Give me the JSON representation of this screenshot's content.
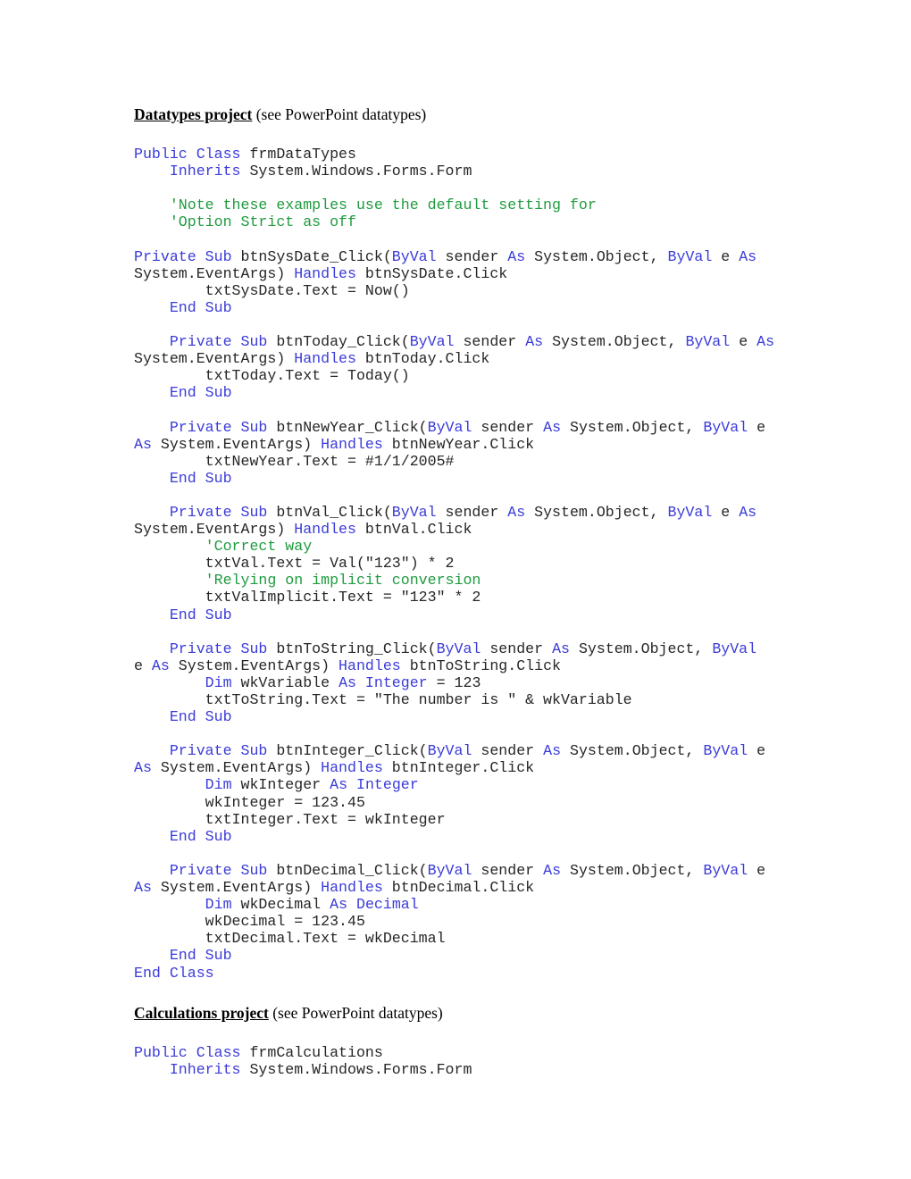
{
  "document": {
    "sections": [
      {
        "id": "datatypes",
        "heading_title": "Datatypes project",
        "heading_suffix": " (see PowerPoint datatypes)",
        "code_lines": [
          [
            {
              "t": "Public Class ",
              "c": "kw"
            },
            {
              "t": "frmDataTypes",
              "c": "id"
            }
          ],
          [
            {
              "t": "    ",
              "c": "id"
            },
            {
              "t": "Inherits ",
              "c": "kw"
            },
            {
              "t": "System.Windows.Forms.Form",
              "c": "id"
            }
          ],
          [],
          [
            {
              "t": "    'Note these examples use the default setting for",
              "c": "cmt"
            }
          ],
          [
            {
              "t": "    'Option Strict as off",
              "c": "cmt"
            }
          ],
          [],
          [
            {
              "t": "Private Sub ",
              "c": "kw"
            },
            {
              "t": "btnSysDate_Click(",
              "c": "id"
            },
            {
              "t": "ByVal ",
              "c": "kw"
            },
            {
              "t": "sender ",
              "c": "id"
            },
            {
              "t": "As ",
              "c": "kw"
            },
            {
              "t": "System.Object, ",
              "c": "id"
            },
            {
              "t": "ByVal ",
              "c": "kw"
            },
            {
              "t": "e ",
              "c": "id"
            },
            {
              "t": "As",
              "c": "kw"
            }
          ],
          [
            {
              "t": "System.EventArgs) ",
              "c": "id"
            },
            {
              "t": "Handles ",
              "c": "kw"
            },
            {
              "t": "btnSysDate.Click",
              "c": "id"
            }
          ],
          [
            {
              "t": "        txtSysDate.Text = Now()",
              "c": "id"
            }
          ],
          [
            {
              "t": "    ",
              "c": "id"
            },
            {
              "t": "End Sub",
              "c": "kw"
            }
          ],
          [],
          [
            {
              "t": "    ",
              "c": "id"
            },
            {
              "t": "Private Sub ",
              "c": "kw"
            },
            {
              "t": "btnToday_Click(",
              "c": "id"
            },
            {
              "t": "ByVal ",
              "c": "kw"
            },
            {
              "t": "sender ",
              "c": "id"
            },
            {
              "t": "As ",
              "c": "kw"
            },
            {
              "t": "System.Object, ",
              "c": "id"
            },
            {
              "t": "ByVal ",
              "c": "kw"
            },
            {
              "t": "e ",
              "c": "id"
            },
            {
              "t": "As",
              "c": "kw"
            }
          ],
          [
            {
              "t": "System.EventArgs) ",
              "c": "id"
            },
            {
              "t": "Handles ",
              "c": "kw"
            },
            {
              "t": "btnToday.Click",
              "c": "id"
            }
          ],
          [
            {
              "t": "        txtToday.Text = Today()",
              "c": "id"
            }
          ],
          [
            {
              "t": "    ",
              "c": "id"
            },
            {
              "t": "End Sub",
              "c": "kw"
            }
          ],
          [],
          [
            {
              "t": "    ",
              "c": "id"
            },
            {
              "t": "Private Sub ",
              "c": "kw"
            },
            {
              "t": "btnNewYear_Click(",
              "c": "id"
            },
            {
              "t": "ByVal ",
              "c": "kw"
            },
            {
              "t": "sender ",
              "c": "id"
            },
            {
              "t": "As ",
              "c": "kw"
            },
            {
              "t": "System.Object, ",
              "c": "id"
            },
            {
              "t": "ByVal ",
              "c": "kw"
            },
            {
              "t": "e",
              "c": "id"
            }
          ],
          [
            {
              "t": "As ",
              "c": "kw"
            },
            {
              "t": "System.EventArgs) ",
              "c": "id"
            },
            {
              "t": "Handles ",
              "c": "kw"
            },
            {
              "t": "btnNewYear.Click",
              "c": "id"
            }
          ],
          [
            {
              "t": "        txtNewYear.Text = #1/1/2005#",
              "c": "id"
            }
          ],
          [
            {
              "t": "    ",
              "c": "id"
            },
            {
              "t": "End Sub",
              "c": "kw"
            }
          ],
          [],
          [
            {
              "t": "    ",
              "c": "id"
            },
            {
              "t": "Private Sub ",
              "c": "kw"
            },
            {
              "t": "btnVal_Click(",
              "c": "id"
            },
            {
              "t": "ByVal ",
              "c": "kw"
            },
            {
              "t": "sender ",
              "c": "id"
            },
            {
              "t": "As ",
              "c": "kw"
            },
            {
              "t": "System.Object, ",
              "c": "id"
            },
            {
              "t": "ByVal ",
              "c": "kw"
            },
            {
              "t": "e ",
              "c": "id"
            },
            {
              "t": "As",
              "c": "kw"
            }
          ],
          [
            {
              "t": "System.EventArgs) ",
              "c": "id"
            },
            {
              "t": "Handles ",
              "c": "kw"
            },
            {
              "t": "btnVal.Click",
              "c": "id"
            }
          ],
          [
            {
              "t": "        ",
              "c": "id"
            },
            {
              "t": "'Correct way",
              "c": "cmt"
            }
          ],
          [
            {
              "t": "        txtVal.Text = Val(\"123\") * 2",
              "c": "id"
            }
          ],
          [
            {
              "t": "        ",
              "c": "id"
            },
            {
              "t": "'Relying on implicit conversion",
              "c": "cmt"
            }
          ],
          [
            {
              "t": "        txtValImplicit.Text = \"123\" * 2",
              "c": "id"
            }
          ],
          [
            {
              "t": "    ",
              "c": "id"
            },
            {
              "t": "End Sub",
              "c": "kw"
            }
          ],
          [],
          [
            {
              "t": "    ",
              "c": "id"
            },
            {
              "t": "Private Sub ",
              "c": "kw"
            },
            {
              "t": "btnToString_Click(",
              "c": "id"
            },
            {
              "t": "ByVal ",
              "c": "kw"
            },
            {
              "t": "sender ",
              "c": "id"
            },
            {
              "t": "As ",
              "c": "kw"
            },
            {
              "t": "System.Object, ",
              "c": "id"
            },
            {
              "t": "ByVal",
              "c": "kw"
            }
          ],
          [
            {
              "t": "e ",
              "c": "id"
            },
            {
              "t": "As ",
              "c": "kw"
            },
            {
              "t": "System.EventArgs) ",
              "c": "id"
            },
            {
              "t": "Handles ",
              "c": "kw"
            },
            {
              "t": "btnToString.Click",
              "c": "id"
            }
          ],
          [
            {
              "t": "        ",
              "c": "id"
            },
            {
              "t": "Dim ",
              "c": "kw"
            },
            {
              "t": "wkVariable ",
              "c": "id"
            },
            {
              "t": "As Integer ",
              "c": "kw"
            },
            {
              "t": "= 123",
              "c": "id"
            }
          ],
          [
            {
              "t": "        txtToString.Text = \"The number is \" & wkVariable",
              "c": "id"
            }
          ],
          [
            {
              "t": "    ",
              "c": "id"
            },
            {
              "t": "End Sub",
              "c": "kw"
            }
          ],
          [],
          [
            {
              "t": "    ",
              "c": "id"
            },
            {
              "t": "Private Sub ",
              "c": "kw"
            },
            {
              "t": "btnInteger_Click(",
              "c": "id"
            },
            {
              "t": "ByVal ",
              "c": "kw"
            },
            {
              "t": "sender ",
              "c": "id"
            },
            {
              "t": "As ",
              "c": "kw"
            },
            {
              "t": "System.Object, ",
              "c": "id"
            },
            {
              "t": "ByVal ",
              "c": "kw"
            },
            {
              "t": "e",
              "c": "id"
            }
          ],
          [
            {
              "t": "As ",
              "c": "kw"
            },
            {
              "t": "System.EventArgs) ",
              "c": "id"
            },
            {
              "t": "Handles ",
              "c": "kw"
            },
            {
              "t": "btnInteger.Click",
              "c": "id"
            }
          ],
          [
            {
              "t": "        ",
              "c": "id"
            },
            {
              "t": "Dim ",
              "c": "kw"
            },
            {
              "t": "wkInteger ",
              "c": "id"
            },
            {
              "t": "As Integer",
              "c": "kw"
            }
          ],
          [
            {
              "t": "        wkInteger = 123.45",
              "c": "id"
            }
          ],
          [
            {
              "t": "        txtInteger.Text = wkInteger",
              "c": "id"
            }
          ],
          [
            {
              "t": "    ",
              "c": "id"
            },
            {
              "t": "End Sub",
              "c": "kw"
            }
          ],
          [],
          [
            {
              "t": "    ",
              "c": "id"
            },
            {
              "t": "Private Sub ",
              "c": "kw"
            },
            {
              "t": "btnDecimal_Click(",
              "c": "id"
            },
            {
              "t": "ByVal ",
              "c": "kw"
            },
            {
              "t": "sender ",
              "c": "id"
            },
            {
              "t": "As ",
              "c": "kw"
            },
            {
              "t": "System.Object, ",
              "c": "id"
            },
            {
              "t": "ByVal ",
              "c": "kw"
            },
            {
              "t": "e",
              "c": "id"
            }
          ],
          [
            {
              "t": "As ",
              "c": "kw"
            },
            {
              "t": "System.EventArgs) ",
              "c": "id"
            },
            {
              "t": "Handles ",
              "c": "kw"
            },
            {
              "t": "btnDecimal.Click",
              "c": "id"
            }
          ],
          [
            {
              "t": "        ",
              "c": "id"
            },
            {
              "t": "Dim ",
              "c": "kw"
            },
            {
              "t": "wkDecimal ",
              "c": "id"
            },
            {
              "t": "As Decimal",
              "c": "kw"
            }
          ],
          [
            {
              "t": "        wkDecimal = 123.45",
              "c": "id"
            }
          ],
          [
            {
              "t": "        txtDecimal.Text = wkDecimal",
              "c": "id"
            }
          ],
          [
            {
              "t": "    ",
              "c": "id"
            },
            {
              "t": "End Sub",
              "c": "kw"
            }
          ],
          [
            {
              "t": "End Class",
              "c": "kw"
            }
          ]
        ]
      },
      {
        "id": "calculations",
        "heading_title": "Calculations project",
        "heading_suffix": " (see PowerPoint datatypes)",
        "code_lines": [
          [
            {
              "t": "Public Class ",
              "c": "kw"
            },
            {
              "t": "frmCalculations",
              "c": "id"
            }
          ],
          [
            {
              "t": "    ",
              "c": "id"
            },
            {
              "t": "Inherits ",
              "c": "kw"
            },
            {
              "t": "System.Windows.Forms.Form",
              "c": "id"
            }
          ]
        ]
      }
    ]
  },
  "colors": {
    "keyword": "#3b3bd9",
    "comment": "#1f9b3f",
    "identifier": "#262626",
    "heading": "#000000",
    "background": "#ffffff"
  }
}
